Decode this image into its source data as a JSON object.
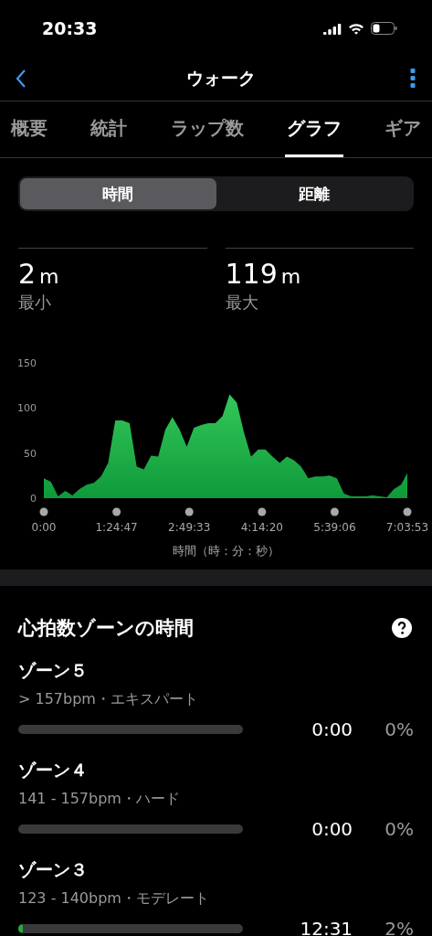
{
  "status_bar": {
    "time": "20:33"
  },
  "nav": {
    "title": "ウォーク"
  },
  "tabs": [
    {
      "label": "概要",
      "selected": false
    },
    {
      "label": "統計",
      "selected": false
    },
    {
      "label": "ラップ数",
      "selected": false
    },
    {
      "label": "グラフ",
      "selected": true
    },
    {
      "label": "ギア",
      "selected": false
    }
  ],
  "segments": [
    {
      "label": "時間",
      "selected": true
    },
    {
      "label": "距離",
      "selected": false
    }
  ],
  "stats": [
    {
      "value": "2",
      "unit": "m",
      "label": "最小"
    },
    {
      "value": "119",
      "unit": "m",
      "label": "最大"
    }
  ],
  "chart_data": {
    "type": "area",
    "xlabel": "時間（時：分：秒）",
    "xlim": [
      0,
      25433
    ],
    "ylim": [
      0,
      150
    ],
    "yticks": [
      0,
      50,
      100,
      150
    ],
    "xticks": [
      {
        "value": 0,
        "label": "0:00"
      },
      {
        "value": 5087,
        "label": "1:24:47"
      },
      {
        "value": 10173,
        "label": "2:49:33"
      },
      {
        "value": 15260,
        "label": "4:14:20"
      },
      {
        "value": 20346,
        "label": "5:39:06"
      },
      {
        "value": 25433,
        "label": "7:03:53"
      }
    ],
    "x": [
      0,
      500,
      1000,
      1500,
      2000,
      2500,
      3000,
      3500,
      4000,
      4500,
      5000,
      5500,
      6000,
      6500,
      7000,
      7500,
      8000,
      8500,
      9000,
      9500,
      10000,
      10500,
      11000,
      11500,
      12000,
      12500,
      13000,
      13500,
      14000,
      14500,
      15000,
      15500,
      16000,
      16500,
      17000,
      17500,
      18000,
      18500,
      19000,
      19500,
      20000,
      20500,
      21000,
      21500,
      22000,
      22500,
      23000,
      23500,
      24000,
      24500,
      25000,
      25433
    ],
    "series": [
      {
        "color": "#34c759",
        "values": [
          22,
          18,
          2,
          8,
          3,
          10,
          15,
          17,
          24,
          39,
          86,
          86,
          83,
          35,
          32,
          47,
          46,
          76,
          90,
          76,
          57,
          78,
          81,
          83,
          83,
          91,
          115,
          106,
          73,
          46,
          54,
          54,
          46,
          39,
          46,
          42,
          35,
          22,
          24,
          24,
          25,
          22,
          5,
          2,
          2,
          2,
          3,
          2,
          1,
          10,
          15,
          28
        ]
      }
    ]
  },
  "zones_section": {
    "title": "心拍数ゾーンの時間"
  },
  "zones": [
    {
      "name": "ゾーン５",
      "range": "> 157bpm・エキスパート",
      "time": "0:00",
      "percent": "0%"
    },
    {
      "name": "ゾーン４",
      "range": "141 - 157bpm・ハード",
      "time": "0:00",
      "percent": "0%"
    },
    {
      "name": "ゾーン３",
      "range": "123 - 140bpm・モデレート",
      "time": "12:31",
      "percent": "2%",
      "level": 0.02
    }
  ]
}
